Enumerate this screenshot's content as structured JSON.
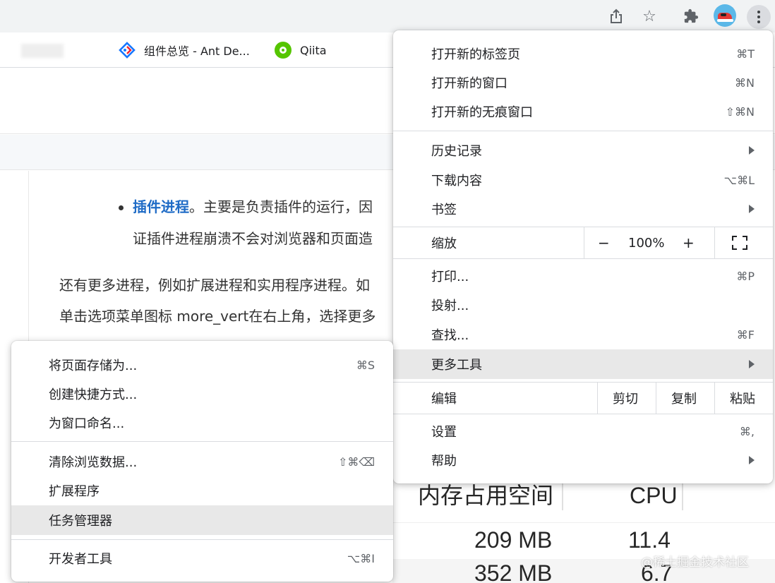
{
  "bookmarks": [
    {
      "label": "组件总览 - Ant De...",
      "icon": "ant-design-icon"
    },
    {
      "label": "Qiita",
      "icon": "qiita-icon"
    }
  ],
  "article": {
    "p1_term": "插件进程",
    "p1_line1_rest": "。主要是负责插件的运行，因",
    "p1_line2": "证插件进程崩溃不会对浏览器和页面造",
    "p2_line1": "还有更多进程，例如扩展进程和实用程序进程。如",
    "p2_line2": "单击选项菜单图标 more_vert在右上角，选择更多"
  },
  "task_manager": {
    "col_memory": "内存占用空间",
    "col_cpu": "CPU",
    "rows": [
      {
        "memory": "209 MB",
        "cpu": "11.4"
      },
      {
        "memory": "352 MB",
        "cpu": "6.7"
      }
    ]
  },
  "main_menu": {
    "new_tab": {
      "label": "打开新的标签页",
      "shortcut": "⌘T"
    },
    "new_window": {
      "label": "打开新的窗口",
      "shortcut": "⌘N"
    },
    "new_incognito": {
      "label": "打开新的无痕窗口",
      "shortcut": "⇧⌘N"
    },
    "history": {
      "label": "历史记录"
    },
    "downloads": {
      "label": "下载内容",
      "shortcut": "⌥⌘L"
    },
    "bookmarks": {
      "label": "书签"
    },
    "zoom": {
      "label": "缩放",
      "minus": "−",
      "value": "100%",
      "plus": "+"
    },
    "print": {
      "label": "打印...",
      "shortcut": "⌘P"
    },
    "cast": {
      "label": "投射..."
    },
    "find": {
      "label": "查找...",
      "shortcut": "⌘F"
    },
    "more_tools": {
      "label": "更多工具"
    },
    "edit": {
      "label": "编辑",
      "cut": "剪切",
      "copy": "复制",
      "paste": "粘贴"
    },
    "settings": {
      "label": "设置",
      "shortcut": "⌘,"
    },
    "help": {
      "label": "帮助"
    }
  },
  "more_tools_menu": {
    "save_page": {
      "label": "将页面存储为...",
      "shortcut": "⌘S"
    },
    "create_shortcut": {
      "label": "创建快捷方式..."
    },
    "name_window": {
      "label": "为窗口命名..."
    },
    "clear_data": {
      "label": "清除浏览数据...",
      "shortcut": "⇧⌘⌫"
    },
    "extensions": {
      "label": "扩展程序"
    },
    "task_manager": {
      "label": "任务管理器"
    },
    "dev_tools": {
      "label": "开发者工具",
      "shortcut": "⌥⌘I"
    }
  },
  "watermark": "@稀土掘金技术社区",
  "colors": {
    "toolbar": "#f1f3f4",
    "highlight": "#e8e8e8",
    "link": "#1e6bc6",
    "qiita": "#55c500"
  }
}
